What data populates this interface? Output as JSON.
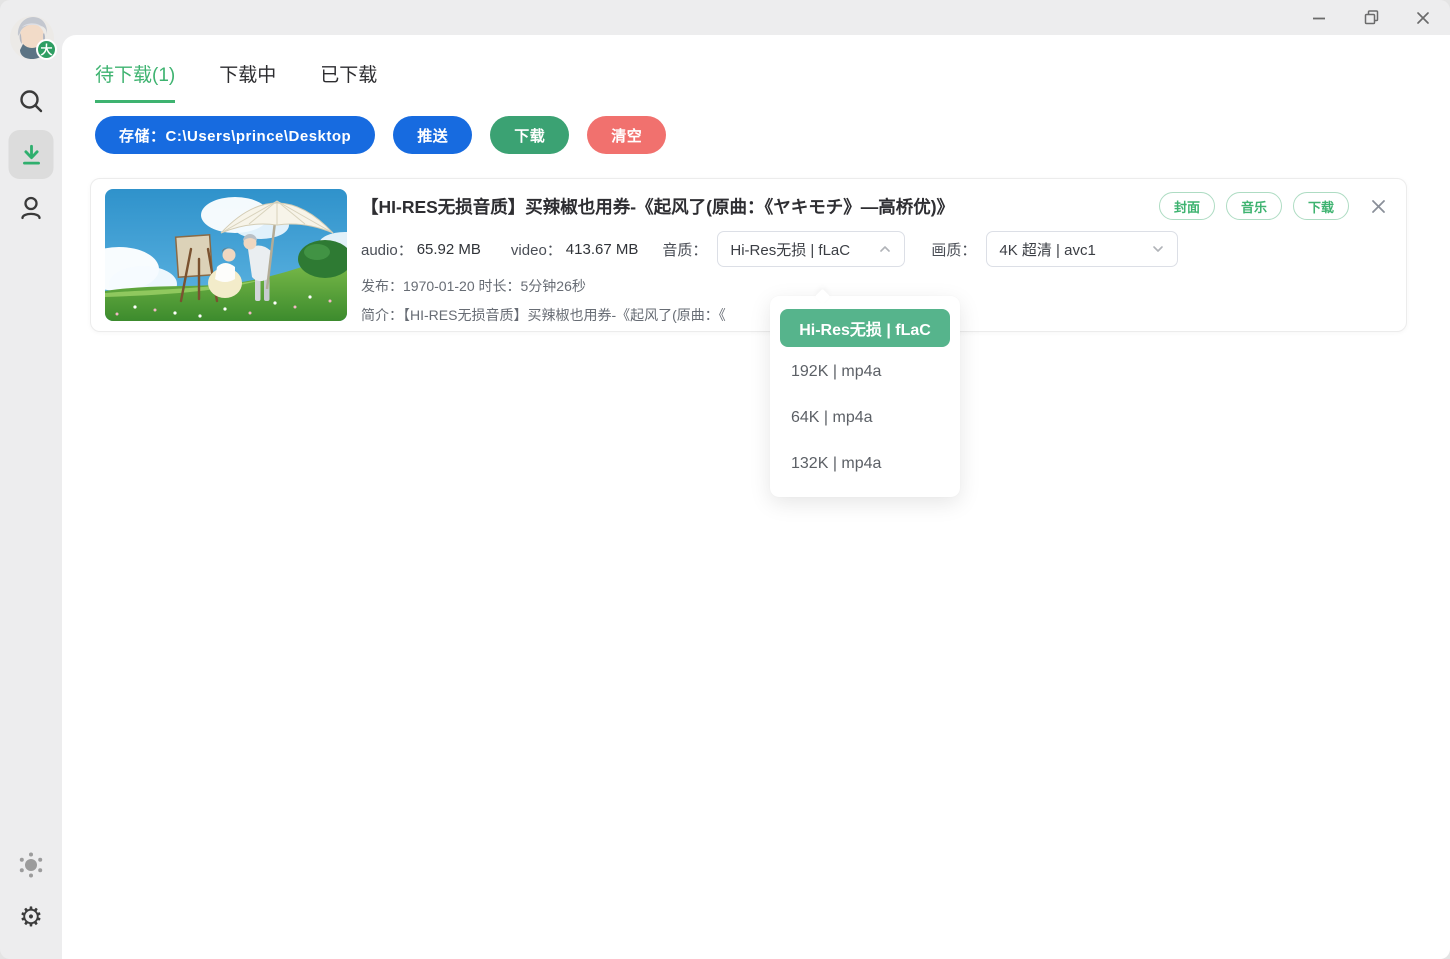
{
  "sidebar": {
    "avatar_badge": "大",
    "icons": [
      "search-icon",
      "download-nav-icon",
      "user-icon",
      "theme-icon",
      "settings-icon"
    ]
  },
  "icons": {
    "settings": "⚙"
  },
  "tabs": [
    {
      "label": "待下载(1)",
      "active": true
    },
    {
      "label": "下载中",
      "active": false
    },
    {
      "label": "已下载",
      "active": false
    }
  ],
  "toolbar": {
    "storage_label": "存储：C:\\Users\\prince\\Desktop",
    "push_label": "推送",
    "download_label": "下载",
    "clear_label": "清空"
  },
  "card": {
    "title": "【HI-RES无损音质】买辣椒也用券-《起风了(原曲：《ヤキモチ》—高桥优)》",
    "badges": [
      "封面",
      "音乐",
      "下载"
    ],
    "audio_label": "audio：",
    "audio_size": "65.92 MB",
    "video_label": "video：",
    "video_size": "413.67 MB",
    "audio_quality_label": "音质：",
    "audio_quality_value": "Hi-Res无损 | fLaC",
    "video_quality_label": "画质：",
    "video_quality_value": "4K 超清 | avc1",
    "publish_label": "发布：",
    "publish_value": "1970-01-20",
    "duration_label": "时长：",
    "duration_value": "5分钟26秒",
    "desc_label": "简介：",
    "desc_text": "【HI-RES无损音质】买辣椒也用券-《起风了(原曲：《"
  },
  "dropdown": {
    "selected": "Hi-Res无损 | fLaC",
    "options": [
      "192K | mp4a",
      "64K | mp4a",
      "132K | mp4a"
    ]
  },
  "colors": {
    "accent_green": "#3eb370",
    "button_green": "#3ba273",
    "selected_option_green": "#56b48c",
    "primary_blue": "#176be0",
    "danger_red": "#f1716e"
  }
}
